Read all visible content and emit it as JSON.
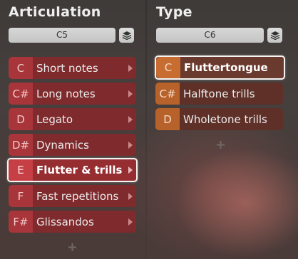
{
  "articulation": {
    "title": "Articulation",
    "key_value": "C5",
    "items": [
      {
        "key": "C",
        "label": "Short notes"
      },
      {
        "key": "C#",
        "label": "Long notes"
      },
      {
        "key": "D",
        "label": "Legato"
      },
      {
        "key": "D#",
        "label": "Dynamics"
      },
      {
        "key": "E",
        "label": "Flutter & trills"
      },
      {
        "key": "F",
        "label": "Fast repetitions"
      },
      {
        "key": "F#",
        "label": "Glissandos"
      }
    ],
    "selected_index": 4
  },
  "type": {
    "title": "Type",
    "key_value": "C6",
    "items": [
      {
        "key": "C",
        "label": "Fluttertongue"
      },
      {
        "key": "C#",
        "label": "Halftone trills"
      },
      {
        "key": "D",
        "label": "Wholetone trills"
      }
    ],
    "selected_index": 0
  },
  "colors": {
    "articulation_accent": "#a8353a",
    "type_accent": "#b8622b",
    "selection_outline": "#f4f4f4"
  },
  "icons": {
    "stack": "layers-icon",
    "row_arrow": "chevron-right-icon",
    "add": "plus-icon"
  }
}
